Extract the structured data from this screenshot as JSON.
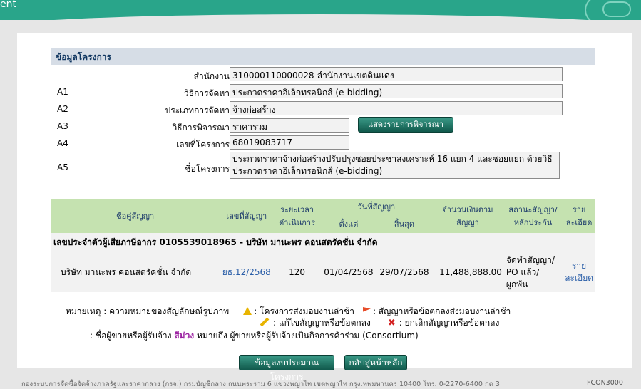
{
  "banner": {
    "text": "ent"
  },
  "section": {
    "title": "ข้อมูลโครงการ"
  },
  "fields": [
    {
      "code": "",
      "label": "สำนักงาน",
      "value": "310000110000028-สำนักงานเขตดินแดง"
    },
    {
      "code": "A1",
      "label": "วิธีการจัดหา",
      "value": "ประกวดราคาอิเล็กทรอนิกส์ (e-bidding)"
    },
    {
      "code": "A2",
      "label": "ประเภทการจัดหา",
      "value": "จ้างก่อสร้าง"
    },
    {
      "code": "A3",
      "label": "วิธีการพิจารณา",
      "value": "ราคารวม"
    },
    {
      "code": "A4",
      "label": "เลขที่โครงการ",
      "value": "68019083717"
    },
    {
      "code": "A5",
      "label": "ชื่อโครงการ",
      "value": "ประกวดราคาจ้างก่อสร้างปรับปรุงซอยประชาสงเคราะห์ 16 แยก 4 และซอยแยก ด้วยวิธีประกวดราคาอิเล็กทรอนิกส์ (e-bidding)"
    }
  ],
  "buttons": {
    "show_criteria": "แสดงรายการพิจารณา",
    "budget_info": "ข้อมูลงบประมาณโครงการ",
    "back_main": "กลับสู่หน้าหลัก"
  },
  "table": {
    "headers": {
      "party": "ชื่อคู่สัญญา",
      "contract_no": "เลขที่สัญญา",
      "duration": "ระยะเวลาดำเนินการ",
      "contract_date": "วันที่สัญญา",
      "from": "ตั้งแต่",
      "to": "สิ้นสุด",
      "amount": "จำนวนเงินตามสัญญา",
      "status": "สถานะสัญญา/หลักประกัน",
      "detail": "รายละเอียด"
    },
    "vendor_line": "เลขประจำตัวผู้เสียภาษีอากร 0105539018965 - บริษัท มานะพร คอนสตรัคชั่น จำกัด",
    "rows": [
      {
        "party": "บริษัท มานะพร คอนสตรัคชั่น จำกัด",
        "contract_no": "ยธ.12/2568",
        "duration": "120",
        "from": "01/04/2568",
        "to": "29/07/2568",
        "amount": "11,488,888.00",
        "status": "จัดทำสัญญา/ PO แล้ว/ ผูกพัน",
        "detail": "รายละเอียด"
      }
    ]
  },
  "legend": {
    "title": "หมายเหตุ : ความหมายของสัญลักษณ์รูปภาพ",
    "late_project": ": โครงการส่งมอบงานล่าช้า",
    "late_contract": ": สัญญาหรือข้อตกลงส่งมอบงานล่าช้า",
    "edit_contract": ": แก้ไขสัญญาหรือข้อตกลง",
    "cancel_contract": ": ยกเลิกสัญญาหรือข้อตกลง",
    "consortium_prefix": ": ชื่อผู้ขายหรือผู้รับจ้าง",
    "consortium_color": "สีม่วง",
    "consortium_suffix": "หมายถึง ผู้ขายหรือผู้รับจ้างเป็นกิจการค้าร่วม (Consortium)"
  },
  "footer": {
    "text": "กองระบบการจัดซื้อจัดจ้างภาครัฐและราคากลาง (กรจ.) กรมบัญชีกลาง ถนนพระราม 6 แขวงพญาไท เขตพญาไท กรุงเทพมหานคร 10400 โทร. 0-2270-6400 กด 3",
    "page_code": "FCON3000"
  },
  "colors": {
    "banner": "#29a58a",
    "header_bar": "#d6dde6",
    "table_header": "#c5e2b0",
    "button": "#1f6f60",
    "link": "#2a5ea8",
    "consortium": "#9a1ea0"
  }
}
